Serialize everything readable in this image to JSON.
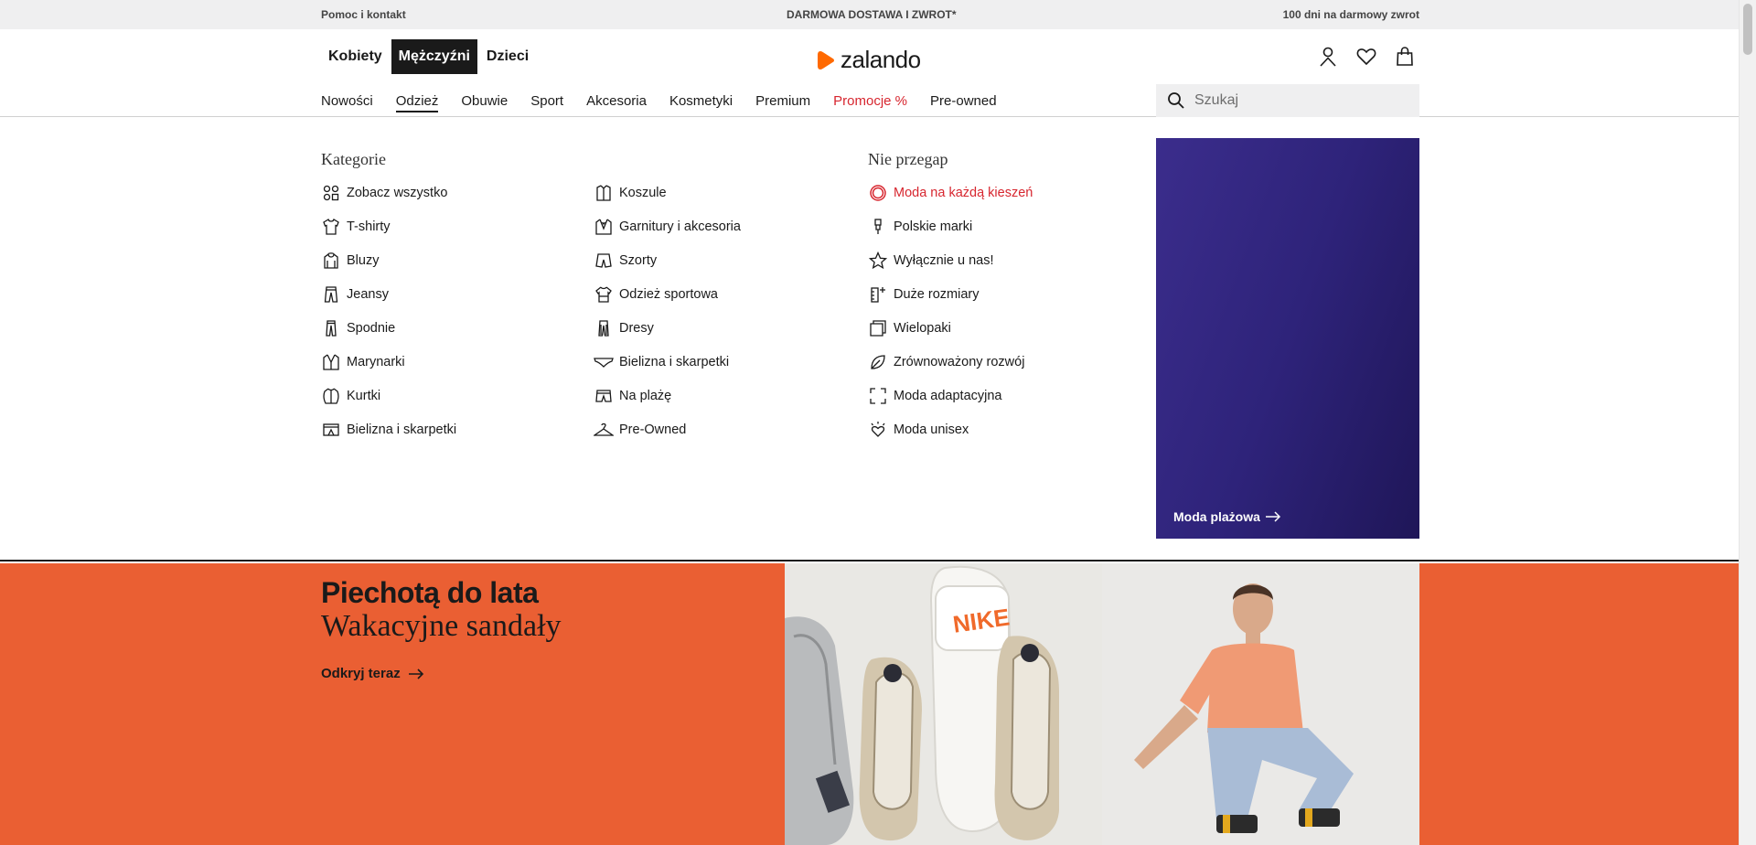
{
  "topbar": {
    "help": "Pomoc i kontakt",
    "delivery": "DARMOWA DOSTAWA I ZWROT*",
    "returns": "100 dni na darmowy zwrot"
  },
  "header": {
    "gender_tabs": [
      "Kobiety",
      "Mężczyźni",
      "Dzieci"
    ],
    "active_gender": "Mężczyźni",
    "logo_text": "zalando",
    "nav": [
      "Nowości",
      "Odzież",
      "Obuwie",
      "Sport",
      "Akcesoria",
      "Kosmetyki",
      "Premium",
      "Promocje %",
      "Pre-owned"
    ],
    "active_nav": "Odzież",
    "search_placeholder": "Szukaj"
  },
  "megamenu": {
    "col1": {
      "title": "Kategorie",
      "items": [
        "Zobacz wszystko",
        "T-shirty",
        "Bluzy",
        "Jeansy",
        "Spodnie",
        "Marynarki",
        "Kurtki",
        "Bielizna i skarpetki"
      ]
    },
    "col2": {
      "items": [
        "Koszule",
        "Garnitury i akcesoria",
        "Szorty",
        "Odzież sportowa",
        "Dresy",
        "Bielizna i skarpetki",
        "Na plażę",
        "Pre-Owned"
      ]
    },
    "col3": {
      "title": "Nie przegap",
      "items": [
        "Moda na każdą kieszeń",
        "Polskie marki",
        "Wyłącznie u nas!",
        "Duże rozmiary",
        "Wielopaki",
        "Zrównoważony rozwój",
        "Moda adaptacyjna",
        "Moda unisex"
      ]
    },
    "promo_card_label": "Moda plażowa"
  },
  "hero": {
    "title": "Piechotą do lata",
    "subtitle": "Wakacyjne sandały",
    "cta": "Odkryj teraz",
    "slide_text": "NIKE"
  },
  "colors": {
    "accent_orange": "#ea5f33",
    "logo_orange": "#ff6900",
    "promo_red": "#d7262f",
    "promo_card": "#2e237a"
  }
}
